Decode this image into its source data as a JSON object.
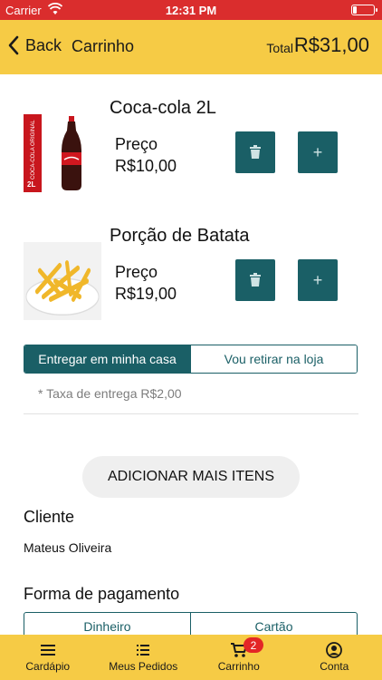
{
  "status_bar": {
    "carrier": "Carrier",
    "time": "12:31 PM"
  },
  "header": {
    "back_label": "Back",
    "title": "Carrinho",
    "total_label": "Total",
    "total_value": "R$31,00"
  },
  "cart_items": [
    {
      "name": "Coca-cola 2L",
      "price_label": "Preço",
      "price": "R$10,00",
      "image": "coca-cola-bottle",
      "box_text": "COCA-COLA ORIGINAL",
      "box_size": "2L"
    },
    {
      "name": "Porção de Batata",
      "price_label": "Preço",
      "price": "R$19,00",
      "image": "french-fries-plate"
    }
  ],
  "delivery": {
    "options": [
      "Entregar em minha casa",
      "Vou retirar na loja"
    ],
    "selected": "Entregar em minha casa",
    "fee_note": "* Taxa de entrega R$2,00"
  },
  "add_more_label": "ADICIONAR MAIS ITENS",
  "client": {
    "title": "Cliente",
    "name": "Mateus Oliveira"
  },
  "payment": {
    "title": "Forma de pagamento",
    "options": [
      "Dinheiro",
      "Cartão"
    ]
  },
  "tabbar": {
    "tabs": [
      {
        "label": "Cardápio",
        "icon": "menu-icon"
      },
      {
        "label": "Meus Pedidos",
        "icon": "list-icon"
      },
      {
        "label": "Carrinho",
        "icon": "cart-icon",
        "badge": "2"
      },
      {
        "label": "Conta",
        "icon": "account-icon"
      }
    ]
  },
  "colors": {
    "primary": "#1a5f66",
    "header": "#f6cb45",
    "status_bar": "#da2d2d",
    "badge": "#e32626"
  }
}
